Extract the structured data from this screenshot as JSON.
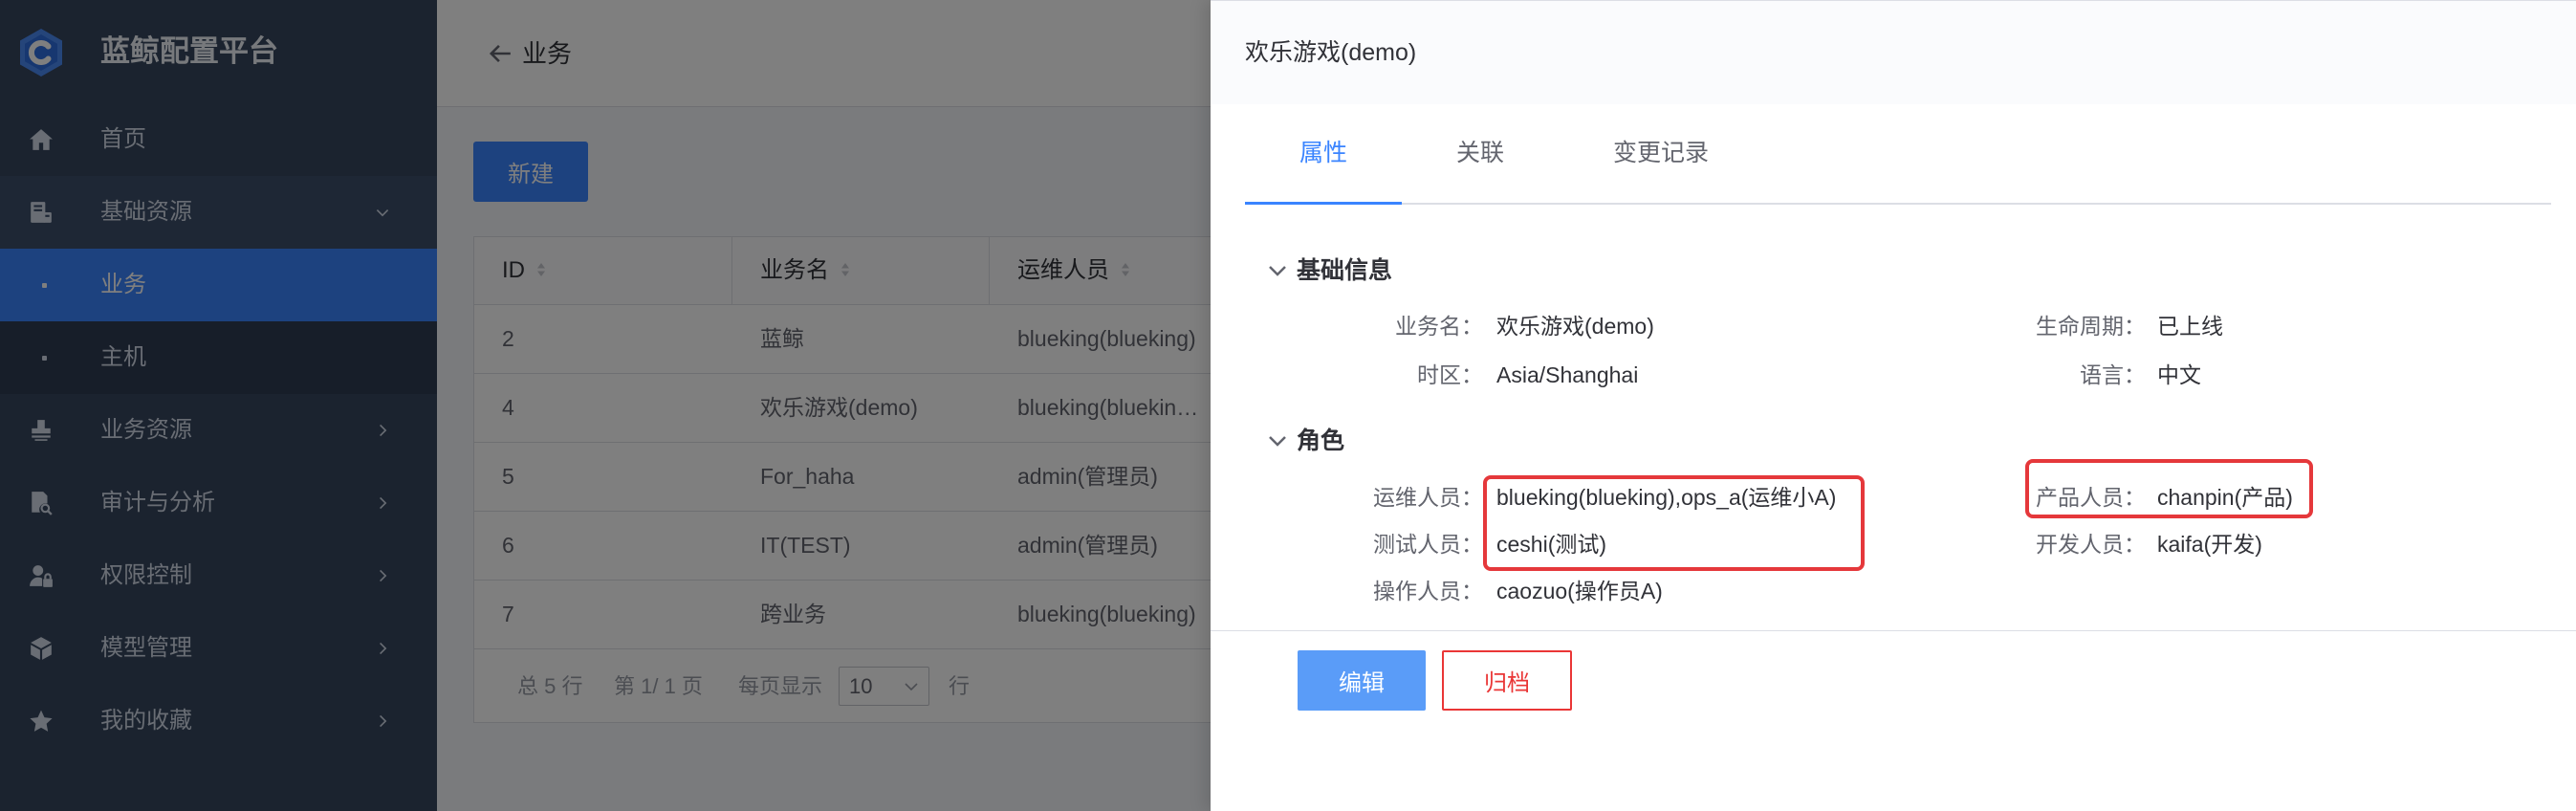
{
  "app": {
    "title": "蓝鲸配置平台",
    "logo_icon": "logo-hexagon-icon"
  },
  "sidebar": {
    "items": [
      {
        "label": "首页",
        "icon": "home-icon"
      },
      {
        "label": "基础资源",
        "icon": "server-icon",
        "expanded": true
      },
      {
        "label": "业务",
        "selected": true
      },
      {
        "label": "主机"
      },
      {
        "label": "业务资源",
        "icon": "stamp-icon"
      },
      {
        "label": "审计与分析",
        "icon": "document-search-icon"
      },
      {
        "label": "权限控制",
        "icon": "user-lock-icon"
      },
      {
        "label": "模型管理",
        "icon": "cube-icon"
      },
      {
        "label": "我的收藏",
        "icon": "star-icon"
      }
    ]
  },
  "main": {
    "header": {
      "title": "业务",
      "back_icon": "arrow-left-icon"
    },
    "create_button": "新建",
    "table": {
      "columns": [
        "ID",
        "业务名",
        "运维人员"
      ],
      "rows": [
        [
          "2",
          "蓝鲸",
          "blueking(blueking)"
        ],
        [
          "4",
          "欢乐游戏(demo)",
          "blueking(bluekin…"
        ],
        [
          "5",
          "For_haha",
          "admin(管理员)"
        ],
        [
          "6",
          "IT(TEST)",
          "admin(管理员)"
        ],
        [
          "7",
          "跨业务",
          "blueking(blueking)"
        ]
      ]
    },
    "pagination": {
      "total": "总 5 行",
      "page": "第 1/ 1 页",
      "page_size_label": "每页显示",
      "page_size": "10",
      "page_size_unit": "行"
    }
  },
  "panel": {
    "title": "欢乐游戏(demo)",
    "tabs": [
      {
        "label": "属性",
        "active": true
      },
      {
        "label": "关联"
      },
      {
        "label": "变更记录"
      }
    ],
    "basic": {
      "title": "基础信息",
      "fields": [
        {
          "label": "业务名：",
          "value": "欢乐游戏(demo)"
        },
        {
          "label": "生命周期：",
          "value": "已上线"
        },
        {
          "label": "时区：",
          "value": "Asia/Shanghai"
        },
        {
          "label": "语言：",
          "value": "中文"
        }
      ]
    },
    "roles": {
      "title": "角色",
      "fields": [
        {
          "label": "运维人员：",
          "value": "blueking(blueking),ops_a(运维小A)"
        },
        {
          "label": "产品人员：",
          "value": "chanpin(产品)"
        },
        {
          "label": "测试人员：",
          "value": "ceshi(测试)"
        },
        {
          "label": "开发人员：",
          "value": "kaifa(开发)"
        },
        {
          "label": "操作人员：",
          "value": "caozuo(操作员A)"
        }
      ]
    },
    "buttons": {
      "edit": "编辑",
      "archive": "归档"
    }
  },
  "colors": {
    "primary": "#3a84ff",
    "edit_button": "#5a9cf8",
    "danger": "#ea3636",
    "annotation": "#e5383b",
    "sidebar_bg": "#36465f",
    "mask": "rgba(0,0,0,0.5)"
  }
}
